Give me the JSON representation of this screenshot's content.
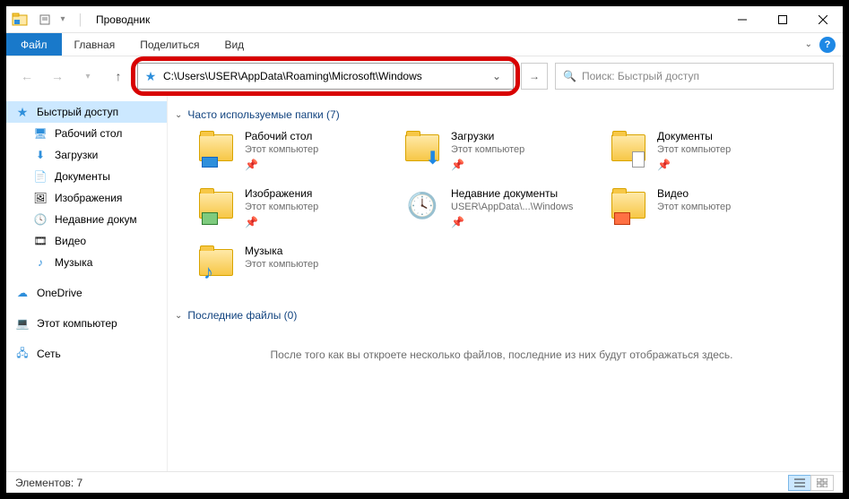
{
  "title": "Проводник",
  "ribbon": {
    "file": "Файл",
    "tabs": [
      "Главная",
      "Поделиться",
      "Вид"
    ]
  },
  "address": {
    "path": "C:\\Users\\USER\\AppData\\Roaming\\Microsoft\\Windows"
  },
  "search": {
    "placeholder": "Поиск: Быстрый доступ"
  },
  "sidebar": {
    "quick": "Быстрый доступ",
    "items": [
      {
        "label": "Рабочий стол"
      },
      {
        "label": "Загрузки"
      },
      {
        "label": "Документы"
      },
      {
        "label": "Изображения"
      },
      {
        "label": "Недавние докум"
      },
      {
        "label": "Видео"
      },
      {
        "label": "Музыка"
      }
    ],
    "onedrive": "OneDrive",
    "thispc": "Этот компьютер",
    "network": "Сеть"
  },
  "sections": {
    "frequent": "Часто используемые папки (7)",
    "recent": "Последние файлы (0)"
  },
  "tiles": [
    {
      "name": "Рабочий стол",
      "sub": "Этот компьютер"
    },
    {
      "name": "Загрузки",
      "sub": "Этот компьютер"
    },
    {
      "name": "Документы",
      "sub": "Этот компьютер"
    },
    {
      "name": "Изображения",
      "sub": "Этот компьютер"
    },
    {
      "name": "Недавние документы",
      "sub": "USER\\AppData\\...\\Windows"
    },
    {
      "name": "Видео",
      "sub": "Этот компьютер"
    },
    {
      "name": "Музыка",
      "sub": "Этот компьютер"
    }
  ],
  "empty_recent": "После того как вы откроете несколько файлов, последние из них будут отображаться здесь.",
  "status": {
    "count": "Элементов: 7"
  }
}
